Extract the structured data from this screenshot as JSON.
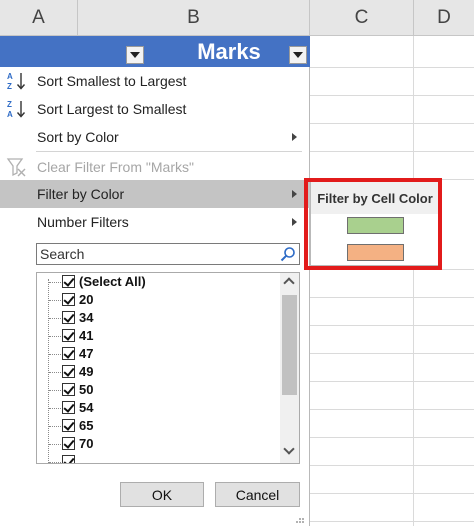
{
  "sheet": {
    "columns": [
      "A",
      "B",
      "C",
      "D"
    ]
  },
  "header_row": {
    "title": "Marks",
    "fill_color": "#4472c4"
  },
  "menu": {
    "items": [
      {
        "label": "Sort Smallest to Largest",
        "icon": "sort-ascending-icon",
        "enabled": true
      },
      {
        "label": "Sort Largest to Smallest",
        "icon": "sort-descending-icon",
        "enabled": true
      },
      {
        "label": "Sort by Color",
        "icon": "",
        "enabled": true,
        "has_submenu": true
      },
      {
        "label": "Clear Filter From \"Marks\"",
        "icon": "clear-filter-icon",
        "enabled": false
      },
      {
        "label": "Filter by Color",
        "icon": "",
        "enabled": true,
        "has_submenu": true,
        "highlighted": true
      },
      {
        "label": "Number Filters",
        "icon": "",
        "enabled": true,
        "has_submenu": true
      }
    ]
  },
  "search": {
    "placeholder": "Search",
    "icon": "search-icon"
  },
  "values_list": {
    "items": [
      {
        "label": "(Select All)",
        "checked": true
      },
      {
        "label": "20",
        "checked": true
      },
      {
        "label": "34",
        "checked": true
      },
      {
        "label": "41",
        "checked": true
      },
      {
        "label": "47",
        "checked": true
      },
      {
        "label": "49",
        "checked": true
      },
      {
        "label": "50",
        "checked": true
      },
      {
        "label": "54",
        "checked": true
      },
      {
        "label": "65",
        "checked": true
      },
      {
        "label": "70",
        "checked": true
      }
    ]
  },
  "buttons": {
    "ok_label": "OK",
    "cancel_label": "Cancel"
  },
  "color_submenu": {
    "title": "Filter by Cell Color",
    "swatches": [
      {
        "color": "#a9d08e"
      },
      {
        "color": "#f4b183"
      }
    ],
    "highlight_color": "#e21b1b"
  }
}
